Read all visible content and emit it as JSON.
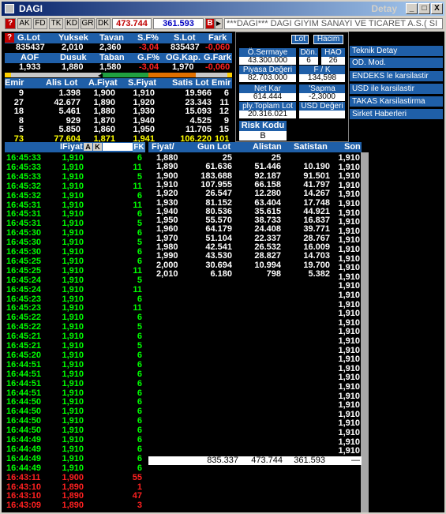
{
  "window": {
    "title": "DAGI",
    "title_right": "Detay",
    "min": "_",
    "max": "□",
    "close": "X"
  },
  "toolbar": {
    "q": "?",
    "buttons": [
      "AK",
      "FD",
      "TK",
      "KD",
      "GR",
      "DK"
    ],
    "value1": "473.744",
    "value2": "361.593",
    "b_label": "B",
    "marquee": "***DAGI*** DAGI GIYIM SANAYI VE TICARET A.S.( SI"
  },
  "summary": {
    "headers": [
      "G.Lot",
      "Yuksek",
      "Tavan",
      "S.F%",
      "S.Lot",
      "Fark"
    ],
    "values": [
      "835437",
      "2,010",
      "2,360",
      "-3,04",
      "835437",
      "-0,060"
    ],
    "headers2": [
      "AOF",
      "Dusuk",
      "Taban",
      "G.F%",
      "OG.Kap.",
      "G.Fark"
    ],
    "values2": [
      "1,933",
      "1,880",
      "1,580",
      "-3,04",
      "1,970",
      "-0,060"
    ]
  },
  "orderbook": {
    "headers": [
      "Emir",
      "Alis Lot",
      "A.Fiyat",
      "S.Fiyat",
      "Satis Lot",
      "Emir"
    ],
    "rows": [
      [
        "9",
        "1.398",
        "1,900",
        "1,910",
        "19.966",
        "6"
      ],
      [
        "27",
        "42.677",
        "1,890",
        "1,920",
        "23.343",
        "11"
      ],
      [
        "18",
        "5.461",
        "1,880",
        "1,930",
        "15.093",
        "12"
      ],
      [
        "8",
        "929",
        "1,870",
        "1,940",
        "4.525",
        "9"
      ],
      [
        "5",
        "5.850",
        "1,860",
        "1,950",
        "11.705",
        "15"
      ],
      [
        "73",
        "77.604",
        "1,871",
        "1,941",
        "106.220",
        "101"
      ]
    ]
  },
  "panel": {
    "btn_lot": "Lot",
    "btn_hacim": "Hacim",
    "o_sermaye_label": "Ö.Sermaye",
    "o_sermaye_value": "43.300.000",
    "don_label": "Dön.",
    "don_value": "6",
    "hao_label": "HAO",
    "hao_value": "26",
    "piyasa_label": "Piyasa Değeri",
    "piyasa_value": "82.703.000",
    "fk_label": "F / K",
    "fk_value": "134,598",
    "netkar_label": "Net Kar",
    "netkar_value": "614.444",
    "sapma_label": "'Sapma",
    "sapma_value": "-2,3000",
    "ply_label": "ply.Toplam Lot",
    "ply_value": "20.316.021",
    "usd_label": "USD Değeri",
    "usd_value": "",
    "risk_label": "Risk Kodu",
    "risk_value": "B"
  },
  "side_menu": [
    "Teknik Detay",
    "OD. Mod.",
    "ENDEKS le karsilastir",
    "USD ile karsilastir",
    "TAKAS Karsilastirma",
    "Sirket Haberleri"
  ],
  "grid": {
    "tick_header": "IFiyat",
    "a_label": "A",
    "k_label": "K",
    "fk_label": "FK",
    "depth_headers": [
      "Fiyat/",
      "Gun Lot",
      "Alistan",
      "Satistan",
      "Son"
    ]
  },
  "ticks": [
    [
      "16:45:33",
      "1,910",
      "6",
      "g"
    ],
    [
      "16:45:33",
      "1,910",
      "11",
      "g"
    ],
    [
      "16:45:33",
      "1,910",
      "5",
      "g"
    ],
    [
      "16:45:32",
      "1,910",
      "11",
      "g"
    ],
    [
      "16:45:32",
      "1,910",
      "6",
      "g"
    ],
    [
      "16:45:31",
      "1,910",
      "11",
      "g"
    ],
    [
      "16:45:31",
      "1,910",
      "6",
      "g"
    ],
    [
      "16:45:31",
      "1,910",
      "5",
      "g"
    ],
    [
      "16:45:30",
      "1,910",
      "6",
      "g"
    ],
    [
      "16:45:30",
      "1,910",
      "5",
      "g"
    ],
    [
      "16:45:30",
      "1,910",
      "6",
      "g"
    ],
    [
      "16:45:25",
      "1,910",
      "6",
      "g"
    ],
    [
      "16:45:25",
      "1,910",
      "11",
      "g"
    ],
    [
      "16:45:24",
      "1,910",
      "5",
      "g"
    ],
    [
      "16:45:24",
      "1,910",
      "11",
      "g"
    ],
    [
      "16:45:23",
      "1,910",
      "6",
      "g"
    ],
    [
      "16:45:23",
      "1,910",
      "11",
      "g"
    ],
    [
      "16:45:22",
      "1,910",
      "6",
      "g"
    ],
    [
      "16:45:22",
      "1,910",
      "5",
      "g"
    ],
    [
      "16:45:21",
      "1,910",
      "6",
      "g"
    ],
    [
      "16:45:21",
      "1,910",
      "5",
      "g"
    ],
    [
      "16:45:20",
      "1,910",
      "6",
      "g"
    ],
    [
      "16:44:51",
      "1,910",
      "6",
      "g"
    ],
    [
      "16:44:51",
      "1,910",
      "6",
      "g"
    ],
    [
      "16:44:51",
      "1,910",
      "6",
      "g"
    ],
    [
      "16:44:51",
      "1,910",
      "6",
      "g"
    ],
    [
      "16:44:50",
      "1,910",
      "6",
      "g"
    ],
    [
      "16:44:50",
      "1,910",
      "6",
      "g"
    ],
    [
      "16:44:50",
      "1,910",
      "6",
      "g"
    ],
    [
      "16:44:50",
      "1,910",
      "6",
      "g"
    ],
    [
      "16:44:49",
      "1,910",
      "6",
      "g"
    ],
    [
      "16:44:49",
      "1,910",
      "6",
      "g"
    ],
    [
      "16:44:49",
      "1,910",
      "6",
      "g"
    ],
    [
      "16:44:49",
      "1,910",
      "6",
      "g"
    ],
    [
      "16:43:11",
      "1,900",
      "55",
      "r"
    ],
    [
      "16:43:10",
      "1,890",
      "1",
      "r"
    ],
    [
      "16:43:10",
      "1,890",
      "47",
      "r"
    ],
    [
      "16:43:09",
      "1,890",
      "3",
      "r"
    ]
  ],
  "depth": [
    [
      "1,880",
      "25",
      "25",
      ""
    ],
    [
      "1,890",
      "61.636",
      "51.446",
      "10.190"
    ],
    [
      "1,900",
      "183.688",
      "92.187",
      "91.501"
    ],
    [
      "1,910",
      "107.955",
      "66.158",
      "41.797"
    ],
    [
      "1,920",
      "26.547",
      "12.280",
      "14.267"
    ],
    [
      "1,930",
      "81.152",
      "63.404",
      "17.748"
    ],
    [
      "1,940",
      "80.536",
      "35.615",
      "44.921"
    ],
    [
      "1,950",
      "55.570",
      "38.733",
      "16.837"
    ],
    [
      "1,960",
      "64.179",
      "24.408",
      "39.771"
    ],
    [
      "1,970",
      "51.104",
      "22.337",
      "28.767"
    ],
    [
      "1,980",
      "42.541",
      "26.532",
      "16.009"
    ],
    [
      "1,990",
      "43.530",
      "28.827",
      "14.703"
    ],
    [
      "2,000",
      "30.694",
      "10.994",
      "19.700"
    ],
    [
      "2,010",
      "6.180",
      "798",
      "5.382"
    ]
  ],
  "son": [
    "1,910",
    "1,910",
    "1,910",
    "1,910",
    "1,910",
    "1,910",
    "1,910",
    "1,910",
    "1,910",
    "1,910",
    "1,910",
    "1,910",
    "1,910",
    "1,910",
    "1,910",
    "1,910",
    "1,910",
    "1,910",
    "1,910",
    "1,910",
    "1,910",
    "1,910",
    "1,910",
    "1,910",
    "1,910",
    "1,910",
    "1,910",
    "1,910",
    "1,910",
    "1,910",
    "1,910",
    "1,910",
    "1,910"
  ],
  "total": {
    "gun_lot": "835.337",
    "alistan": "473.744",
    "satistan": "361.593",
    "son": "—"
  },
  "colors": {
    "green": "#00ff00",
    "red": "#ff2020",
    "blue": "#1f5fa8"
  }
}
